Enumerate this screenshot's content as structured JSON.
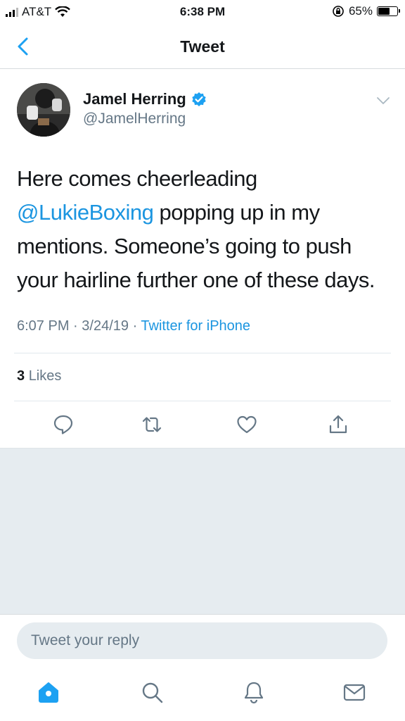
{
  "status_bar": {
    "carrier": "AT&T",
    "time": "6:38 PM",
    "battery": "65%",
    "battery_level": 0.65
  },
  "nav": {
    "title": "Tweet",
    "back_icon": "chevron-left-icon"
  },
  "tweet": {
    "author_name": "Jamel Herring",
    "author_handle": "@JamelHerring",
    "verified": true,
    "text_part1": "Here comes cheerleading ",
    "mention": "@LukieBoxing",
    "text_part2": " popping up in my mentions. Someone’s going to push your hairline further one of these days.",
    "time": "6:07 PM",
    "date": "3/24/19",
    "source": "Twitter for iPhone",
    "likes_count": "3",
    "likes_label": "Likes"
  },
  "actions": [
    "reply-icon",
    "retweet-icon",
    "like-icon",
    "share-icon"
  ],
  "reply": {
    "placeholder": "Tweet your reply"
  },
  "tabbar": [
    "home-icon",
    "search-icon",
    "notifications-icon",
    "messages-icon"
  ],
  "colors": {
    "accent": "#1da1f2",
    "link": "#1b95e0",
    "secondary_text": "#657786",
    "background_gray": "#e6ecf0"
  }
}
